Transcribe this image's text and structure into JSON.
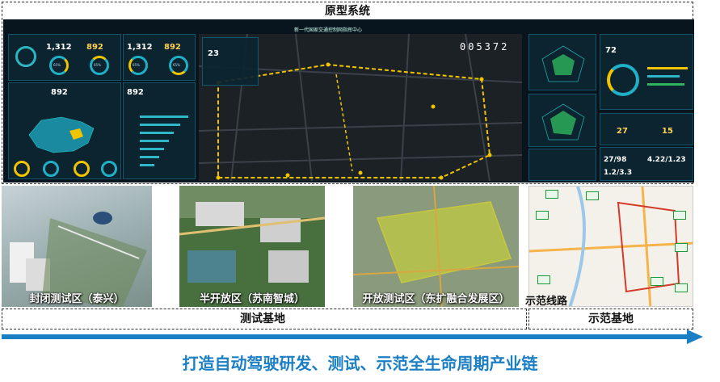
{
  "top": {
    "title": "原型系统"
  },
  "dashboard": {
    "title": "新一代国家交通控制网指挥中心",
    "counter": "005372",
    "stats": [
      "1,312",
      "892",
      "1,312",
      "892"
    ],
    "rings_pct": [
      "65%",
      "65%",
      "65%",
      "65%"
    ],
    "row2_values": [
      "892",
      "892"
    ],
    "temp": "23",
    "right_values": {
      "score": "72",
      "a": "27",
      "b": "15",
      "c": "27/98",
      "d": "4.22/1.23",
      "e": "1.2/3.3"
    }
  },
  "photos": {
    "closed_site": "封闭测试区（泰兴）",
    "semi_open_site": "半开放区（苏南智城）",
    "open_site": "开放测试区（东扩融合发展区）",
    "demo_route": "示范线路"
  },
  "bottom": {
    "test_base": "测试基地",
    "demo_base": "示范基地",
    "slogan": "打造自动驾驶研发、测试、示范全生命周期产业链"
  },
  "colors": {
    "accent": "#1a7fc4",
    "dashboard_bg": "#08151e",
    "route": "#f2c400"
  }
}
